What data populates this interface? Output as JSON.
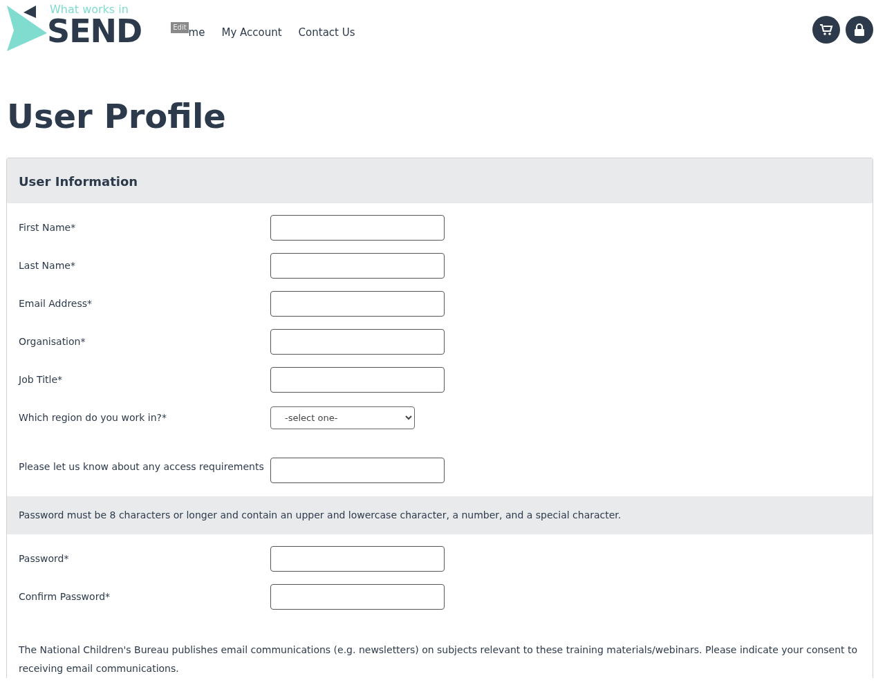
{
  "logo": {
    "tagline": "What works in",
    "name": "SEND"
  },
  "edit_badge": "Edit",
  "nav": [
    {
      "label": "me"
    },
    {
      "label": "My Account"
    },
    {
      "label": "Contact Us"
    }
  ],
  "page_title": "User Profile",
  "card": {
    "header": "User Information",
    "fields": [
      {
        "label": "First Name*",
        "kind": "text"
      },
      {
        "label": "Last Name*",
        "kind": "text"
      },
      {
        "label": "Email Address*",
        "kind": "text"
      },
      {
        "label": "Organisation*",
        "kind": "text"
      },
      {
        "label": "Job Title*",
        "kind": "text"
      },
      {
        "label": "Which region do you work in?*",
        "kind": "select",
        "value": "-select one-"
      },
      {
        "label": "Please let us know about any access requirements",
        "kind": "text"
      }
    ],
    "password_notice": "Password must be 8 characters or longer and contain an upper and lowercase character, a number, and a special character.",
    "password_fields": [
      {
        "label": "Password*",
        "kind": "password"
      },
      {
        "label": "Confirm Password*",
        "kind": "password"
      }
    ],
    "consent_text": "The National Children's Bureau publishes email communications (e.g. newsletters) on subjects relevant to these training materials/webinars. Please indicate your consent to receiving email communications."
  }
}
